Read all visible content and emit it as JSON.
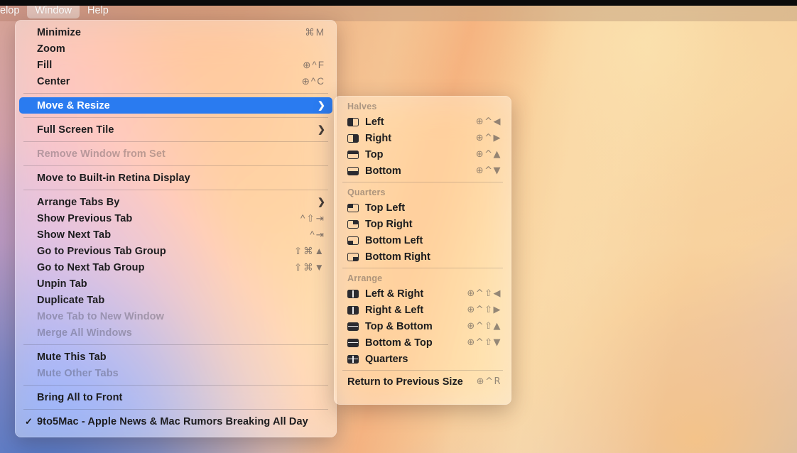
{
  "menubar": {
    "items": [
      {
        "label": "elop",
        "active": false,
        "clipped": true
      },
      {
        "label": "Window",
        "active": true,
        "clipped": false
      },
      {
        "label": "Help",
        "active": false,
        "clipped": false
      }
    ]
  },
  "colors": {
    "selection_blue": "#2a7bf0",
    "menu_text": "#1c1c1e",
    "disabled_text": "rgba(60,60,67,0.34)",
    "shortcut_text": "rgba(60,60,67,0.62)",
    "menubar_highlight": "rgba(255,255,255,0.42)"
  },
  "window_menu": {
    "items": [
      {
        "label": "Minimize",
        "shortcut": "⌘M",
        "state": "normal",
        "submenu": false
      },
      {
        "label": "Zoom",
        "shortcut": "",
        "state": "normal",
        "submenu": false
      },
      {
        "label": "Fill",
        "shortcut": "⊕^F",
        "state": "normal",
        "submenu": false
      },
      {
        "label": "Center",
        "shortcut": "⊕^C",
        "state": "normal",
        "submenu": false
      },
      {
        "separator": true
      },
      {
        "label": "Move & Resize",
        "shortcut": "",
        "state": "selected",
        "submenu": true
      },
      {
        "separator": true
      },
      {
        "label": "Full Screen Tile",
        "shortcut": "",
        "state": "normal",
        "submenu": true
      },
      {
        "separator": true
      },
      {
        "label": "Remove Window from Set",
        "shortcut": "",
        "state": "disabled",
        "submenu": false
      },
      {
        "separator": true
      },
      {
        "label": "Move to Built-in Retina Display",
        "shortcut": "",
        "state": "normal",
        "submenu": false
      },
      {
        "separator": true
      },
      {
        "label": "Arrange Tabs By",
        "shortcut": "",
        "state": "normal",
        "submenu": true
      },
      {
        "label": "Show Previous Tab",
        "shortcut": "^⇧⇥",
        "state": "normal",
        "submenu": false
      },
      {
        "label": "Show Next Tab",
        "shortcut": "^⇥",
        "state": "normal",
        "submenu": false
      },
      {
        "label": "Go to Previous Tab Group",
        "shortcut": "⇧⌘▲",
        "state": "normal",
        "submenu": false
      },
      {
        "label": "Go to Next Tab Group",
        "shortcut": "⇧⌘▼",
        "state": "normal",
        "submenu": false
      },
      {
        "label": "Unpin Tab",
        "shortcut": "",
        "state": "normal",
        "submenu": false
      },
      {
        "label": "Duplicate Tab",
        "shortcut": "",
        "state": "normal",
        "submenu": false
      },
      {
        "label": "Move Tab to New Window",
        "shortcut": "",
        "state": "disabled",
        "submenu": false
      },
      {
        "label": "Merge All Windows",
        "shortcut": "",
        "state": "disabled",
        "submenu": false
      },
      {
        "separator": true
      },
      {
        "label": "Mute This Tab",
        "shortcut": "",
        "state": "normal",
        "submenu": false
      },
      {
        "label": "Mute Other Tabs",
        "shortcut": "",
        "state": "disabled",
        "submenu": false
      },
      {
        "separator": true
      },
      {
        "label": "Bring All to Front",
        "shortcut": "",
        "state": "normal",
        "submenu": false
      },
      {
        "separator": true
      },
      {
        "label": "9to5Mac - Apple News & Mac Rumors Breaking All Day",
        "shortcut": "",
        "state": "normal",
        "submenu": false,
        "checked": true
      }
    ]
  },
  "resize_submenu": {
    "groups": [
      {
        "title": "Halves",
        "items": [
          {
            "label": "Left",
            "icon": "window-half-left-icon",
            "icon_class": "w-left",
            "shortcut": "⊕^◀"
          },
          {
            "label": "Right",
            "icon": "window-half-right-icon",
            "icon_class": "w-right",
            "shortcut": "⊕^▶"
          },
          {
            "label": "Top",
            "icon": "window-half-top-icon",
            "icon_class": "w-top",
            "shortcut": "⊕^▲"
          },
          {
            "label": "Bottom",
            "icon": "window-half-bottom-icon",
            "icon_class": "w-bottom",
            "shortcut": "⊕^▼"
          }
        ]
      },
      {
        "title": "Quarters",
        "items": [
          {
            "label": "Top Left",
            "icon": "window-quarter-top-left-icon",
            "icon_class": "w-tl",
            "shortcut": ""
          },
          {
            "label": "Top Right",
            "icon": "window-quarter-top-right-icon",
            "icon_class": "w-tr",
            "shortcut": ""
          },
          {
            "label": "Bottom Left",
            "icon": "window-quarter-bottom-left-icon",
            "icon_class": "w-bl",
            "shortcut": ""
          },
          {
            "label": "Bottom Right",
            "icon": "window-quarter-bottom-right-icon",
            "icon_class": "w-br",
            "shortcut": ""
          }
        ]
      },
      {
        "title": "Arrange",
        "items": [
          {
            "label": "Left & Right",
            "icon": "arrange-left-right-icon",
            "icon_class": "w-lr filled",
            "shortcut": "⊕^⇧◀"
          },
          {
            "label": "Right & Left",
            "icon": "arrange-right-left-icon",
            "icon_class": "w-rl filled",
            "shortcut": "⊕^⇧▶"
          },
          {
            "label": "Top & Bottom",
            "icon": "arrange-top-bottom-icon",
            "icon_class": "w-tb filled",
            "shortcut": "⊕^⇧▲"
          },
          {
            "label": "Bottom & Top",
            "icon": "arrange-bottom-top-icon",
            "icon_class": "w-bt filled",
            "shortcut": "⊕^⇧▼"
          },
          {
            "label": "Quarters",
            "icon": "arrange-quarters-icon",
            "icon_class": "w-q filled",
            "shortcut": ""
          }
        ]
      }
    ],
    "footer": {
      "label": "Return to Previous Size",
      "shortcut": "⊕^R"
    }
  }
}
